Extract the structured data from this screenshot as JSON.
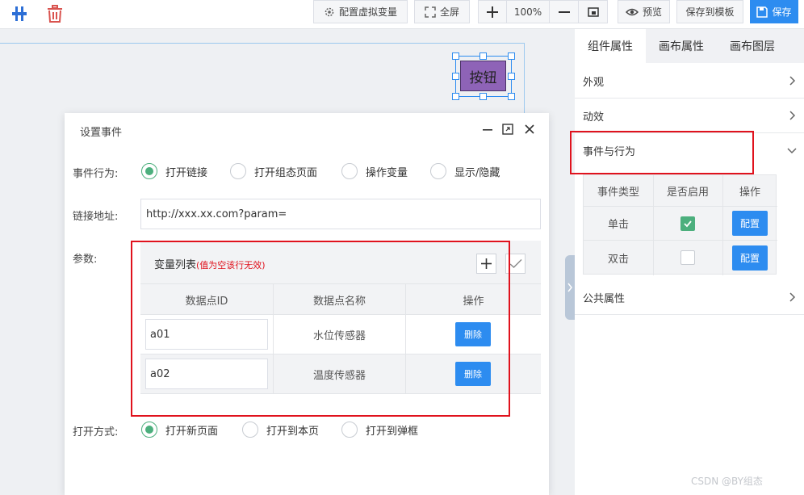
{
  "toolbar": {
    "config_vars_label": "配置虚拟变量",
    "fullscreen_label": "全屏",
    "zoom_level": "100%",
    "preview_label": "预览",
    "save_template_label": "保存到模板",
    "save_label": "保存"
  },
  "canvas": {
    "widget_label": "按钮"
  },
  "right_panel": {
    "tabs": [
      {
        "label": "组件属性"
      },
      {
        "label": "画布属性"
      },
      {
        "label": "画布图层"
      }
    ],
    "sections": {
      "appearance": "外观",
      "animation": "动效",
      "events": "事件与行为",
      "common": "公共属性"
    },
    "event_table": {
      "headers": [
        "事件类型",
        "是否启用",
        "操作"
      ],
      "rows": [
        {
          "type": "单击",
          "enabled": true,
          "action": "配置"
        },
        {
          "type": "双击",
          "enabled": false,
          "action": "配置"
        }
      ]
    }
  },
  "modal": {
    "title": "设置事件",
    "behavior_label": "事件行为:",
    "behavior_options": [
      "打开链接",
      "打开组态页面",
      "操作变量",
      "显示/隐藏"
    ],
    "url_label": "链接地址:",
    "url_value": "http://xxx.xx.com?param=",
    "params_label": "参数:",
    "var_list_title": "变量列表",
    "var_list_hint": "(值为空该行无效)",
    "param_headers": [
      "数据点ID",
      "数据点名称",
      "操作"
    ],
    "param_rows": [
      {
        "id": "a01",
        "name": "水位传感器",
        "action": "删除"
      },
      {
        "id": "a02",
        "name": "温度传感器",
        "action": "删除"
      }
    ],
    "open_mode_label": "打开方式:",
    "open_mode_options": [
      "打开新页面",
      "打开到本页",
      "打开到弹框"
    ]
  },
  "watermark": "CSDN @BY组态",
  "colors": {
    "accent": "#2d8cf0",
    "check_green": "#4caf7d",
    "highlight_red": "#e0121d",
    "widget_purple": "#8e63b7"
  }
}
